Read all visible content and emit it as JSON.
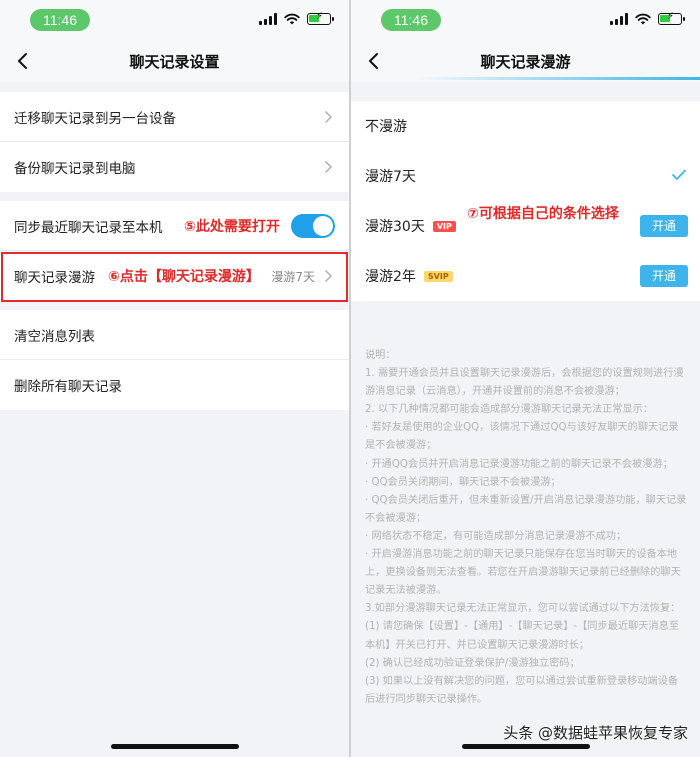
{
  "left": {
    "time": "11:46",
    "title": "聊天记录设置",
    "rows": [
      {
        "label": "迁移聊天记录到另一台设备"
      },
      {
        "label": "备份聊天记录到电脑"
      },
      {
        "label": "同步最近聊天记录至本机",
        "note": "⑤此处需要打开"
      },
      {
        "label": "聊天记录漫游",
        "note": "⑥点击【聊天记录漫游】",
        "value": "漫游7天"
      },
      {
        "label": "清空消息列表"
      },
      {
        "label": "删除所有聊天记录"
      }
    ]
  },
  "right": {
    "time": "11:46",
    "title": "聊天记录漫游",
    "note": "⑦可根据自己的条件选择",
    "options": [
      {
        "label": "不漫游"
      },
      {
        "label": "漫游7天"
      },
      {
        "label": "漫游30天",
        "badge": "VIP",
        "button": "开通"
      },
      {
        "label": "漫游2年",
        "badge": "SVIP",
        "button": "开通"
      }
    ],
    "desc": [
      "说明：",
      "1. 需要开通会员并且设置聊天记录漫游后，会根据您的设置规则进行漫游消息记录（云消息），开通并设置前的消息不会被漫游；",
      "2. 以下几种情况都可能会造成部分漫游聊天记录无法正常显示：",
      "· 若好友是使用的企业QQ，该情况下通过QQ与该好友聊天的聊天记录是不会被漫游；",
      "· 开通QQ会员并开启消息记录漫游功能之前的聊天记录不会被漫游；",
      "· QQ会员关闭期间，聊天记录不会被漫游；",
      "· QQ会员关闭后重开，但未重新设置/开启消息记录漫游功能，聊天记录不会被漫游；",
      "· 网络状态不稳定，有可能造成部分消息记录漫游不成功；",
      "· 开启漫游消息功能之前的聊天记录只能保存在您当时聊天的设备本地上，更换设备则无法查看。若您在开启漫游聊天记录前已经删除的聊天记录无法被漫游。",
      "3.如部分漫游聊天记录无法正常显示，您可以尝试通过以下方法恢复：",
      "(1) 请您确保【设置】-【通用】-【聊天记录】-【同步最近聊天消息至本机】开关已打开、并已设置聊天记录漫游时长；",
      "(2) 确认已经成功验证登录保护/漫游独立密码；",
      "(3) 如果以上没有解决您的问题，您可以通过尝试重新登录移动端设备后进行同步聊天记录操作。"
    ]
  },
  "watermark": "头条 @数据蛙苹果恢复专家",
  "colors": {
    "toggle_on": "#20a0e8",
    "annotation_red": "#e02a2a",
    "button_blue": "#3eb4ec"
  }
}
